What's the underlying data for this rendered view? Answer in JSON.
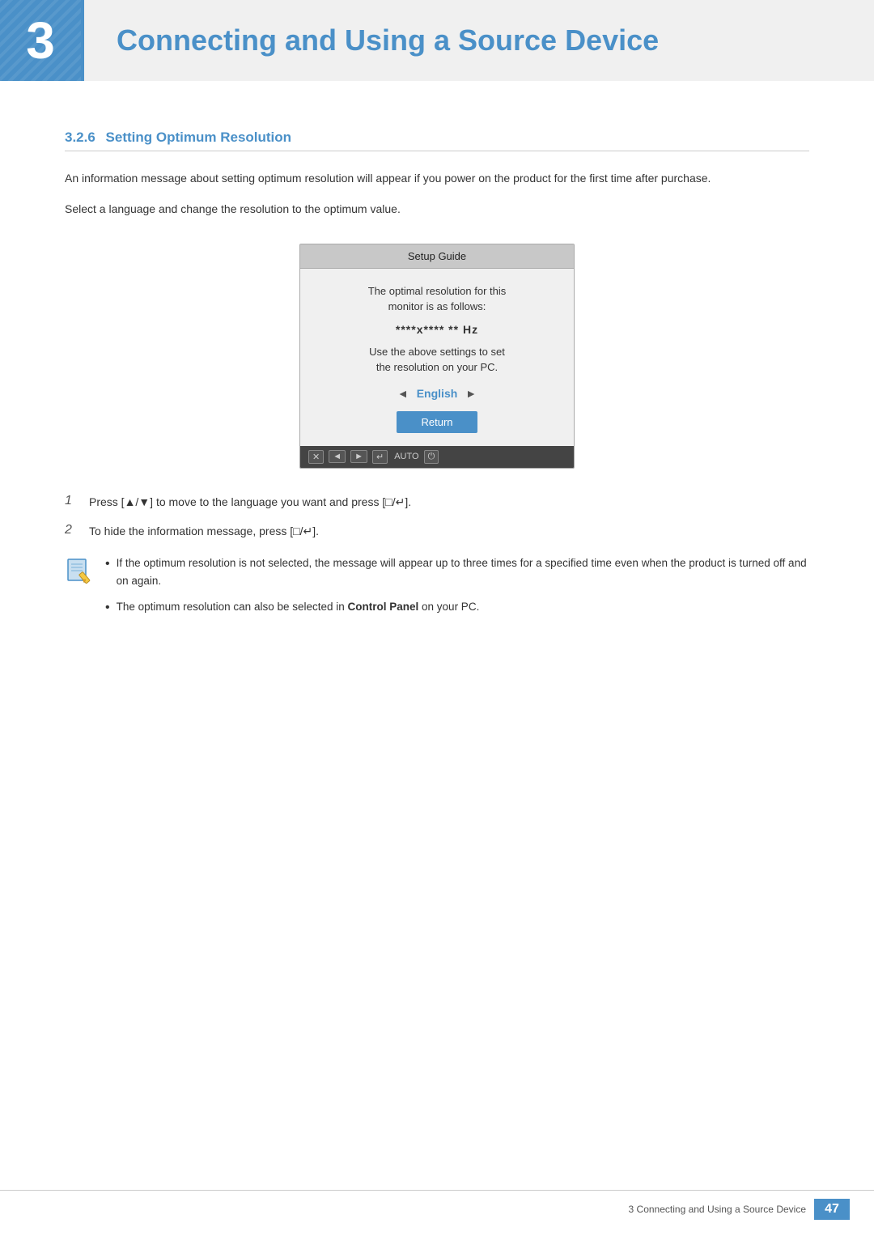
{
  "header": {
    "chapter_number": "3",
    "chapter_title": "Connecting and Using a Source Device"
  },
  "section": {
    "number": "3.2.6",
    "title": "Setting Optimum Resolution"
  },
  "body": {
    "paragraph1": "An information message about setting optimum resolution will appear if you power on the product for the first time after purchase.",
    "paragraph2": "Select a language and change the resolution to the optimum value."
  },
  "dialog": {
    "title": "Setup Guide",
    "resolution_line1": "The optimal resolution for this",
    "resolution_line2": "monitor is as follows:",
    "resolution_value": "****x****  ** Hz",
    "instruction_line1": "Use the above settings to set",
    "instruction_line2": "the resolution on your PC.",
    "language": "English",
    "return_button": "Return",
    "footer_icons": [
      "✕",
      "◄",
      "►",
      "↵",
      "AUTO",
      "⏻"
    ]
  },
  "steps": [
    {
      "number": "1",
      "text_before": "Press [▲/▼] to move to the language you want and press [□/↵]."
    },
    {
      "number": "2",
      "text_before": "To hide the information message, press [□/↵]."
    }
  ],
  "notes": [
    {
      "text": "If the optimum resolution is not selected, the message will appear up to three times for a specified time even when the product is turned off and on again."
    },
    {
      "text_before": "The optimum resolution can also be selected in ",
      "bold_text": "Control Panel",
      "text_after": " on your PC."
    }
  ],
  "footer": {
    "chapter_text": "3 Connecting and Using a Source Device",
    "page_number": "47"
  }
}
